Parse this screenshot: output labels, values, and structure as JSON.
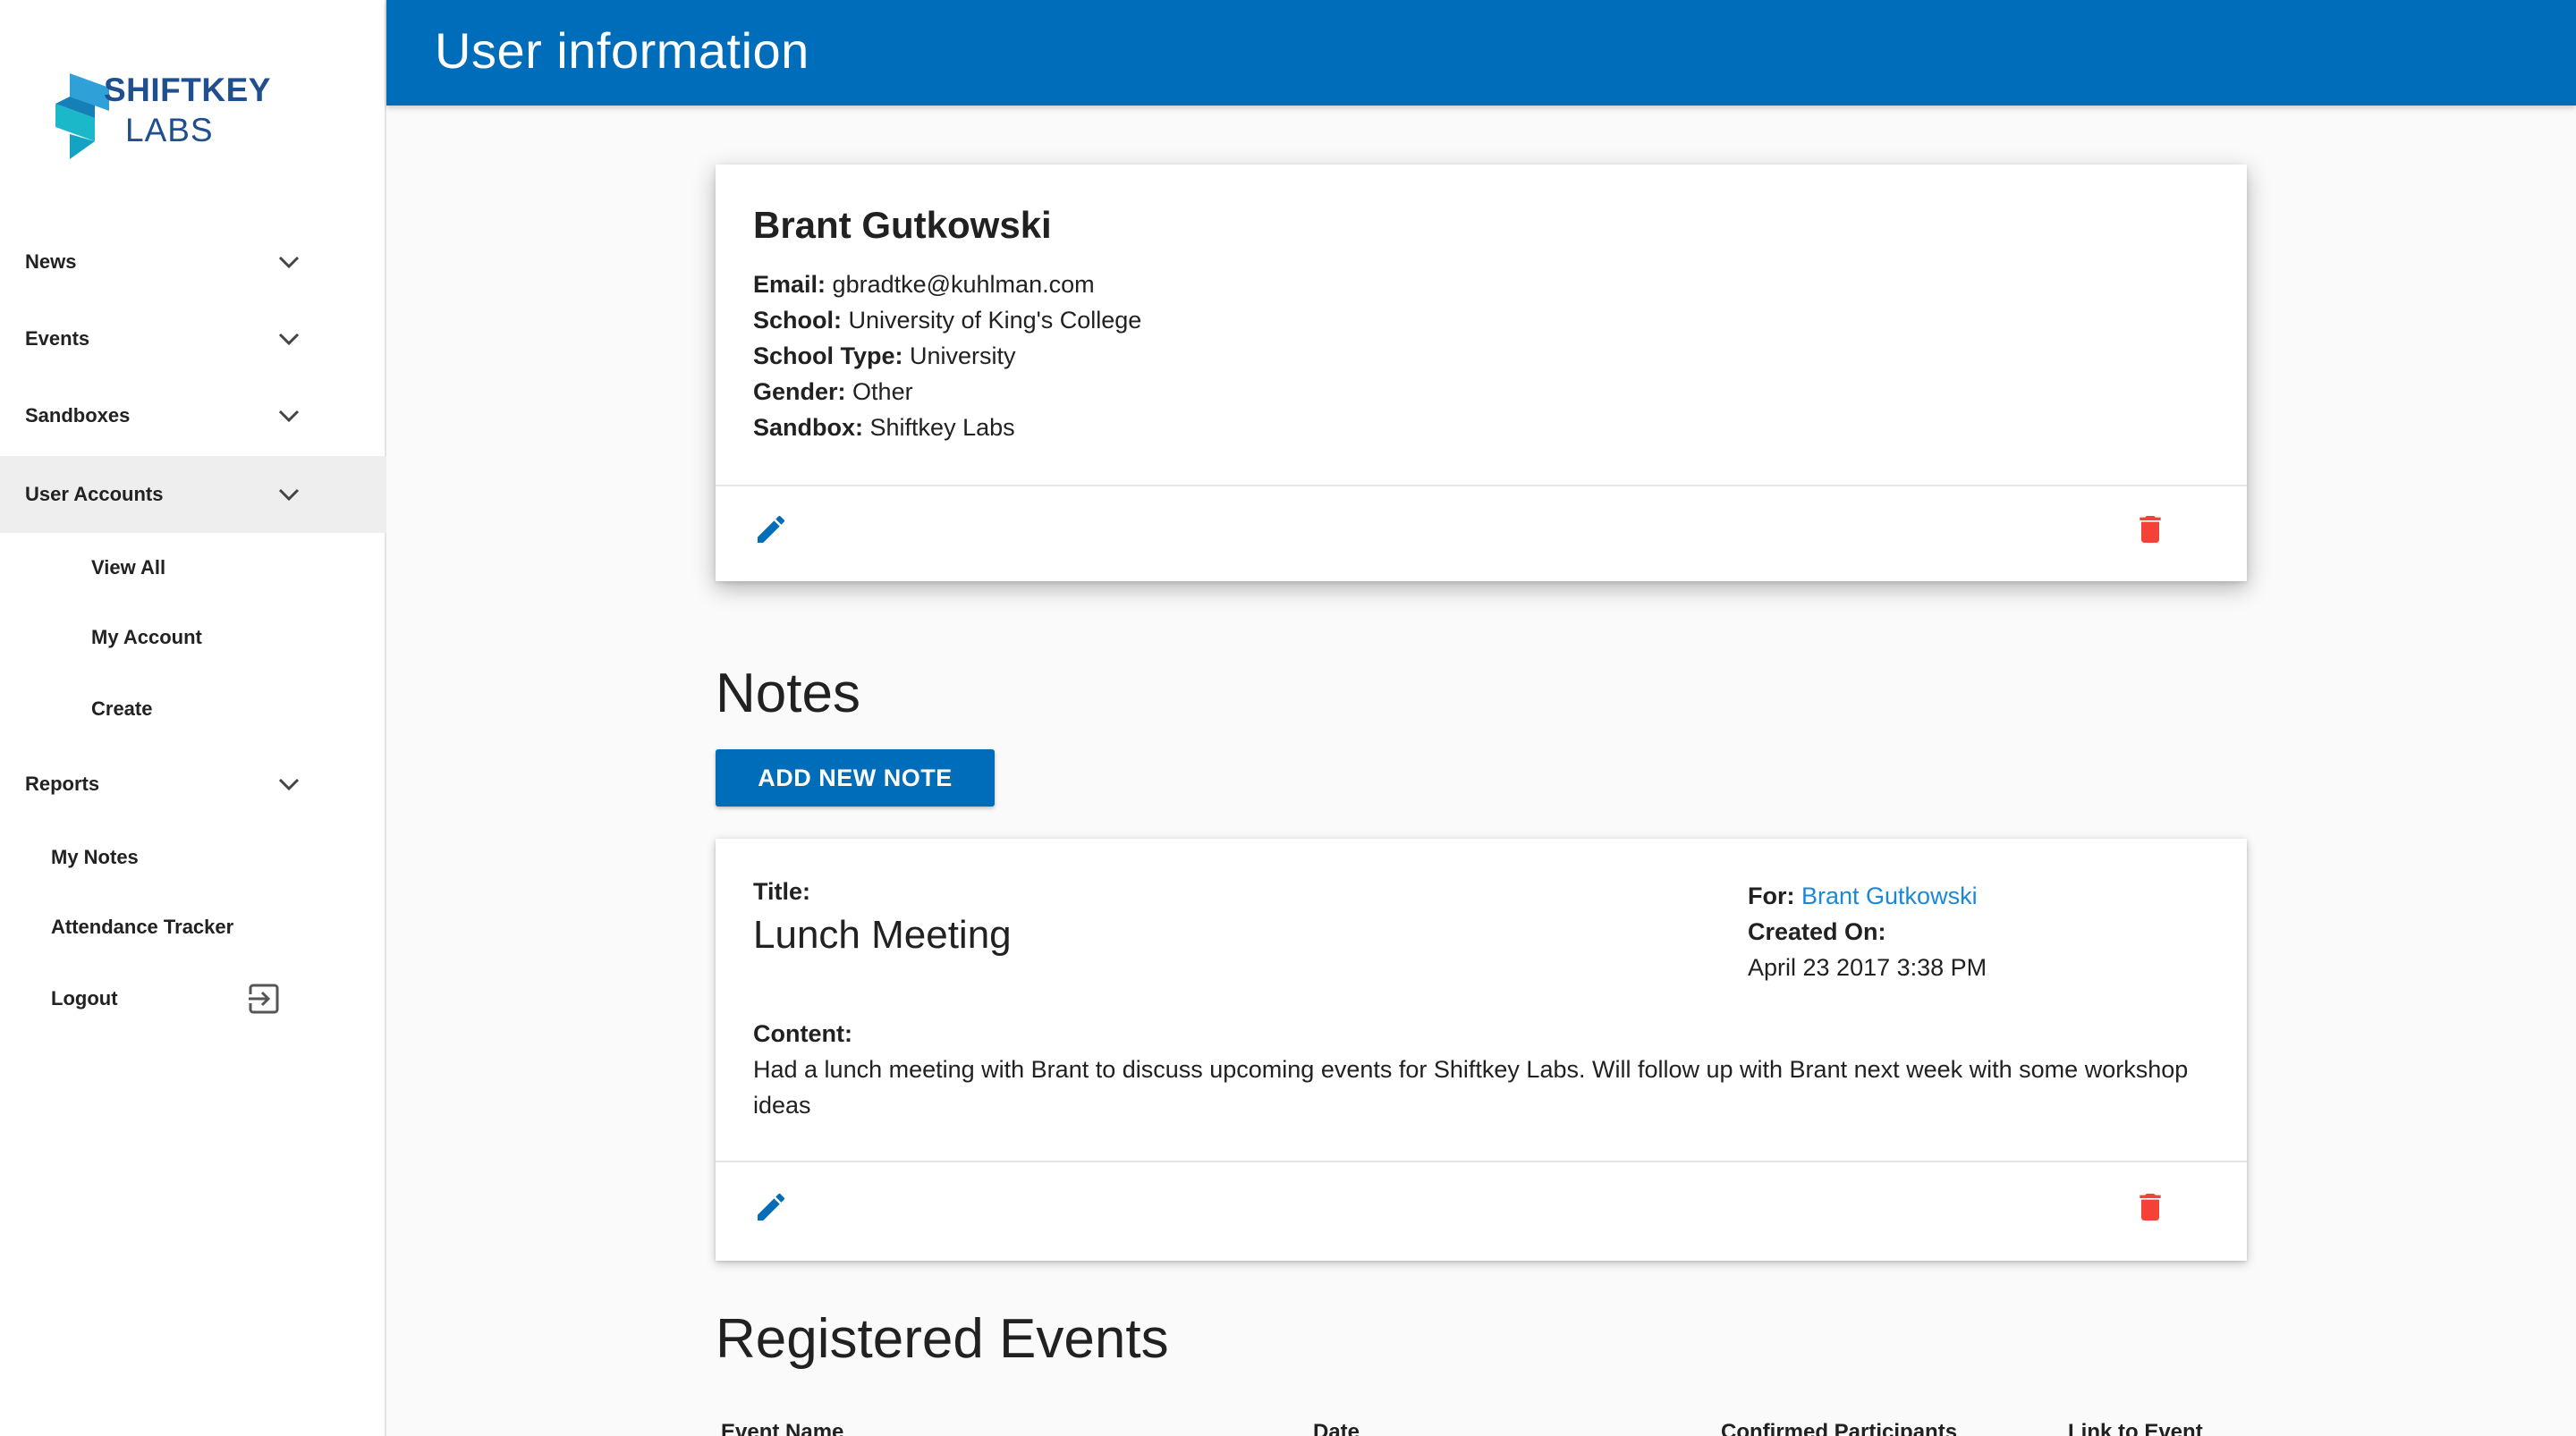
{
  "sidebar": {
    "logo": {
      "line1": "SHIFTKEY",
      "line2": "LABS"
    },
    "items": [
      {
        "label": "News"
      },
      {
        "label": "Events"
      },
      {
        "label": "Sandboxes"
      },
      {
        "label": "User Accounts"
      },
      {
        "label": "View All"
      },
      {
        "label": "My Account"
      },
      {
        "label": "Create"
      },
      {
        "label": "Reports"
      },
      {
        "label": "My Notes"
      },
      {
        "label": "Attendance Tracker"
      },
      {
        "label": "Logout"
      }
    ]
  },
  "header": {
    "title": "User information"
  },
  "user": {
    "name": "Brant Gutkowski",
    "fields": [
      {
        "label": "Email:",
        "value": "gbradtke@kuhlman.com"
      },
      {
        "label": "School:",
        "value": "University of King's College"
      },
      {
        "label": "School Type:",
        "value": "University"
      },
      {
        "label": "Gender:",
        "value": "Other"
      },
      {
        "label": "Sandbox:",
        "value": "Shiftkey Labs"
      }
    ]
  },
  "notes": {
    "heading": "Notes",
    "add_button": "ADD NEW NOTE",
    "items": [
      {
        "title_label": "Title:",
        "title": "Lunch Meeting",
        "for_label": "For:",
        "for_value": "Brant Gutkowski",
        "created_label": "Created On:",
        "created_value": "April 23 2017 3:38 PM",
        "content_label": "Content:",
        "content_line1": "Had a lunch meeting with Brant to discuss upcoming events for Shiftkey Labs. Will follow up with Brant next week with some workshop",
        "content_line2": "ideas"
      }
    ]
  },
  "events": {
    "heading": "Registered Events",
    "columns": [
      "Event Name",
      "Date",
      "Confirmed Participants",
      "Link to Event"
    ]
  },
  "colors": {
    "primary": "#006dbb",
    "link": "#1a88d8",
    "danger": "#f44336",
    "active_nav": "#eeeeee"
  }
}
